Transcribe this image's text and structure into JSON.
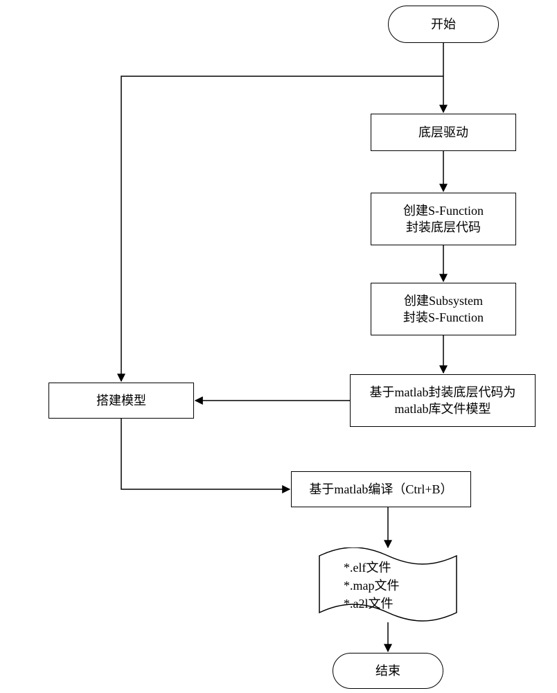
{
  "terminator": {
    "start": "开始",
    "end": "结束"
  },
  "right_chain": {
    "driver": "底层驱动",
    "sfunc": "创建S-Function\n封装底层代码",
    "subsystem": "创建Subsystem\n封装S-Function",
    "library": "基于matlab封装底层代码为\nmatlab库文件模型"
  },
  "left": {
    "model": "搭建模型"
  },
  "compile": {
    "label": "基于matlab编译（Ctrl+B）"
  },
  "output_files": {
    "text": "*.elf文件\n*.map文件\n*.a2l文件"
  }
}
